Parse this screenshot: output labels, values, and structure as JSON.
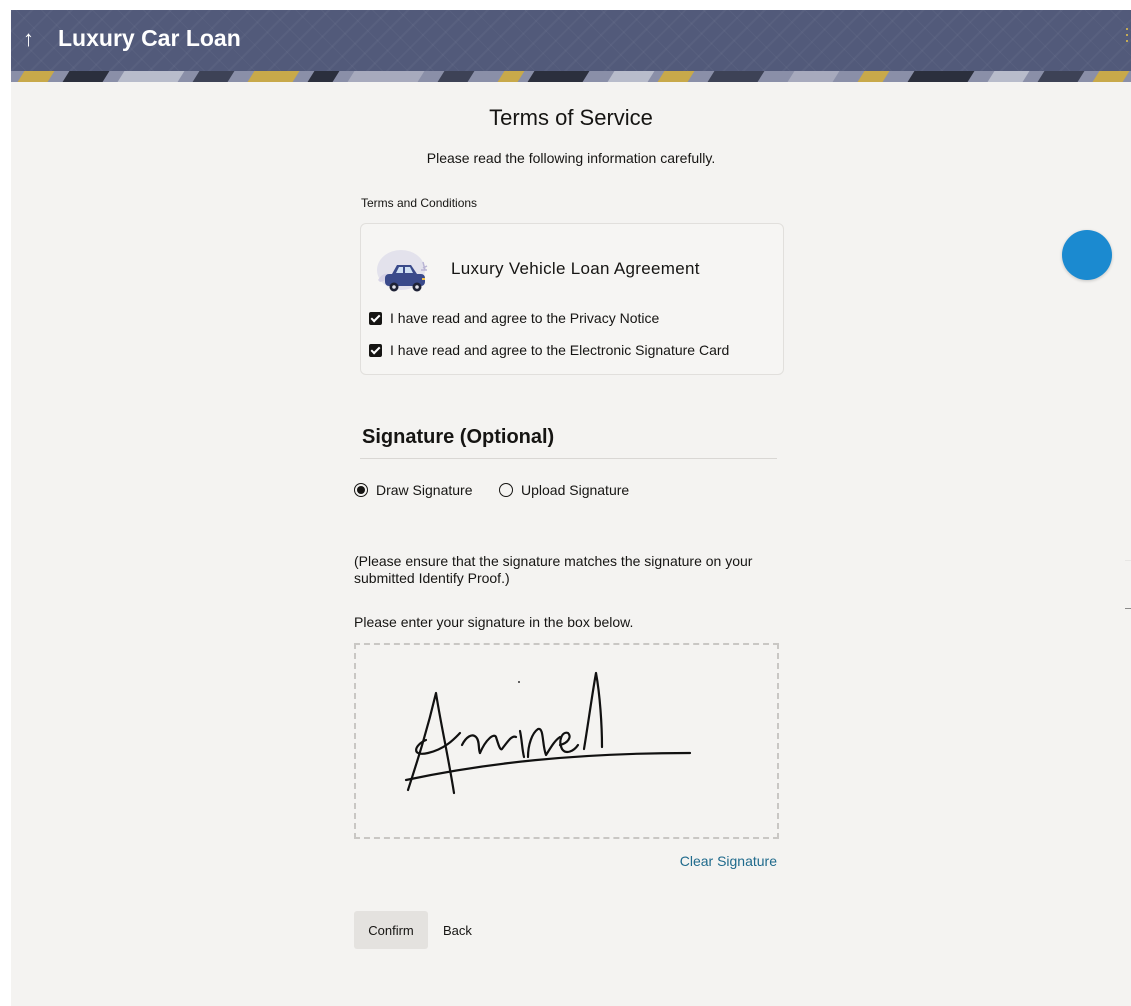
{
  "header": {
    "back_icon": "↑",
    "title": "Luxury Car Loan",
    "menu_icon": "kebab-menu-icon"
  },
  "terms": {
    "heading": "Terms of Service",
    "subheading": "Please read the following information carefully.",
    "section_label": "Terms and Conditions",
    "agreement_title": "Luxury Vehicle Loan Agreement",
    "agreement_icon": "car-illustration",
    "checkboxes": [
      {
        "label": "I have read and agree to the Privacy Notice",
        "checked": true
      },
      {
        "label": "I have read and agree to the Electronic Signature Card",
        "checked": true
      }
    ]
  },
  "signature": {
    "heading": "Signature (Optional)",
    "options": [
      {
        "label": "Draw Signature",
        "selected": true
      },
      {
        "label": "Upload Signature",
        "selected": false
      }
    ],
    "ensure_note": "(Please ensure that the signature matches the signature on your submitted Identify Proof.)",
    "instruction": "Please enter your signature in the box below.",
    "clear_label": "Clear Signature"
  },
  "actions": {
    "confirm_label": "Confirm",
    "back_label": "Back"
  },
  "colors": {
    "header_bg": "#525a7a",
    "page_bg": "#f4f3f1",
    "link": "#1f6a8c",
    "help_button": "#1b8ad0"
  }
}
